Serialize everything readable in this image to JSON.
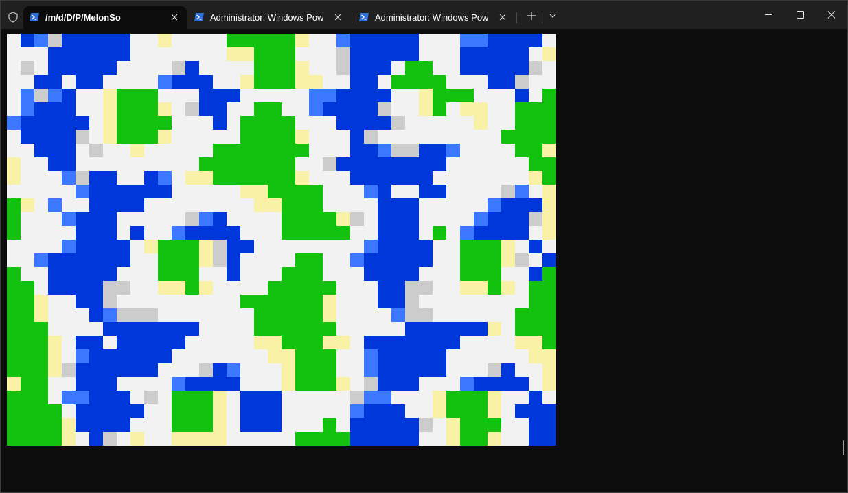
{
  "window": {
    "tabs": [
      {
        "label": "/m/d/D/P/MelonSoc",
        "active": true
      },
      {
        "label": "Administrator: Windows PowerShell",
        "active": false
      },
      {
        "label": "Administrator: Windows PowerShell",
        "active": false
      }
    ],
    "new_tab_icon": "plus-icon",
    "dropdown_icon": "chevron-down-icon",
    "controls": [
      "minimize-icon",
      "maximize-icon",
      "close-icon"
    ]
  },
  "colors": {
    "titlebar": "#202020",
    "terminal_bg": "#0c0c0c",
    "palette": {
      "B": "#0037DA",
      "L": "#3B78FF",
      "G": "#13C10F",
      "W": "#F2F2F2",
      "Y": "#F9F1A5",
      "S": "#CCCCCC"
    }
  },
  "terminal": {
    "cols": 40,
    "rows": 33,
    "grid": [
      "WBLSBBBBBWWYWWWWGGGGGYWWLBBBBBWWWLLBBBBW",
      "WWWBBBBBBWWWWWWWYYGGGWWWSBBBBBWWWBBBBBWY",
      "WSWBBBBBWWWWSBWWWWGGGYWWSBBBWGGWWBBBBBSW",
      "WWBBWBBWWWWLBBBWWYGGGYYWWBBWGGGGWWWBBSWW",
      "WLSLBWWYGGGWWWBBBWWWWWLLBBBBWWYGGGWWWBWG",
      "WLBBBWWYGGGYWSBBWWGGWWLBBBBSWWYGWYYWWGGG",
      "LBBBBBWYGGGGWWWBWGGGGWWWBBBBSWWWWWYWWGGG",
      "WBBBBSWYGGGYWWWWWGGGGYWWWBSWWWWWWWWWGGGG",
      "WWBBBWSWWYWWWWWGGGGGGGWWWBBLSSBBLWWWWGGY",
      "YWWBBWWWWWWWWWGGGGGGGWWSBBBBBBBBWWWWWWGG",
      "YWWWLSBBWWBLWYYGGGGGGYWWWBBBBBBWWWWWWWYG",
      "WWWWWLBBBBBBWWWWWYYGGGGWWWLBWWBBWWWWSLWY",
      "GYWLWWBBBBWWWWWWWWYYGGGWWWWBBBWWWWWLBBBY",
      "GWWWLBBBWWWWWSLBWWWWGGGGYSWBBBWWWWLBBBSY",
      "GWWWWBBBWBWWLBBBBWWWGGGGGWWBBBWGWLBBBBWY",
      "WWWWLBBBBWYGGGYSBBWWWWWWWWLBBBBWWGGGYWBW",
      "WWLBBBBBBWWGGGYSBWWWWGGWWLBBBBBWWGGGYSWB",
      "GWWBBBBBWWWGGGWWBWWWGGGWWWBBBBWWWGGGWWBG",
      "GGWBBBBSSWWYYGYWWWWGGGGGWWWBBSSWWYYGYWGG",
      "GGYWWBBSWWWWWWWWWGGGGGGYWWWBBSWWWWWWWWGG",
      "GGYWWWBLSSSWWWWWWWGGGGGYWWWWLSSWWWWWWGGG",
      "GGGWWWWBBBBBBBWWWWGGGGGGWWWWWBBBBBBYWGGG",
      "GGGYWBBWBBBBBWWWWWYYGGGYYWBBBBBBBWWWWYYG",
      "GGGYWLBBBBBBWWWWWWWYYGGGWWLBBBBBWWWWWWYY",
      "GGGYSBBBBBBWWWSBLWWWYGGGWWLBBBBBWWWSBWWY",
      "YGGWWBBBWWWWLBBBBWWWYGGGYWSBBBWWWLBBBBWY",
      "GGGWLLBBBWSWGGGYWBBBWWWWWSLLWWWYGGGYWWBW",
      "GGGGWBBBBBWWGGGYWBBBWWWWWLBBBWWYGGGYWBBB",
      "GGGGYBBBBWWWGGGYWBBBWWWGWBBBBBSWYGGGWWBB",
      "GGGGYWBSWYWWYYYYWWWWWGGGGBBBBBWWYGGYWWBB"
    ]
  }
}
